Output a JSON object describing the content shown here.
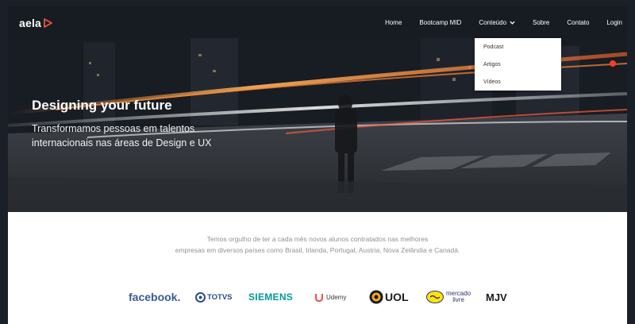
{
  "header": {
    "logo_text": "aela",
    "nav": {
      "home": "Home",
      "bootcamp": "Bootcamp MID",
      "conteudo": "Conteúdo",
      "sobre": "Sobre",
      "contato": "Contato",
      "login": "Login"
    },
    "dropdown": [
      "Podcast",
      "Artigos",
      "Vídeos"
    ]
  },
  "hero": {
    "title": "Designing your future",
    "subtitle": "Transformamos pessoas em talentos internacionais nas áreas de Design e UX"
  },
  "companies": {
    "line1": "Temos orgulho de ter a cada mês novos alunos contratados nas melhores",
    "line2": "empresas em diversos países como Brasil, Irlanda, Portugal, Austria, Nova Zelândia e Canadá.",
    "logos": {
      "facebook": "facebook.",
      "totvs": "TOTVS",
      "siemens": "SIEMENS",
      "udemy": "Udemy",
      "uol": "UOL",
      "mercado_line1": "mercado",
      "mercado_line2": "livre",
      "mjv": "MJV"
    }
  },
  "colors": {
    "header_bg": "#171b22",
    "accent": "#e8553d",
    "facebook": "#3b5998",
    "siemens": "#009999",
    "udemy": "#ec5252",
    "text_gray": "#8e9298"
  }
}
